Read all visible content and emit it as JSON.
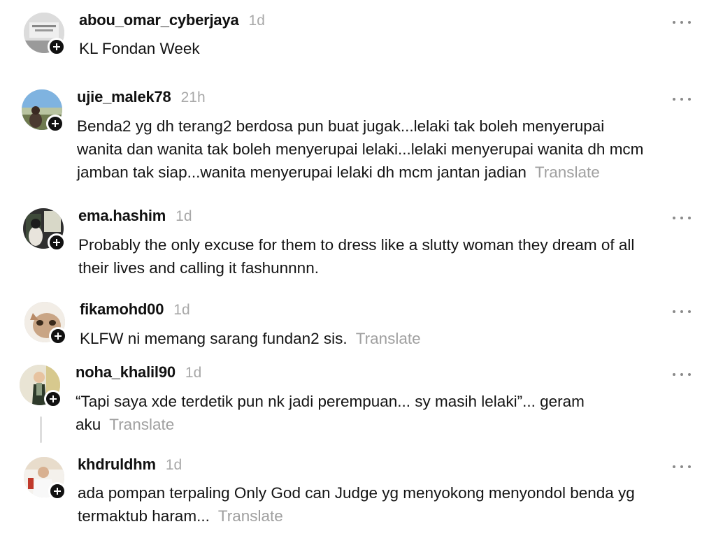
{
  "comments": [
    {
      "username": "abou_omar_cyberjaya",
      "time": "1d",
      "lines": [
        "KL Fondan Week"
      ],
      "translate": ""
    },
    {
      "username": "ujie_malek78",
      "time": "21h",
      "lines": [
        "Benda2 yg dh terang2 berdosa pun buat jugak...lelaki tak boleh menyerupai",
        "wanita dan wanita tak boleh menyerupai lelaki...lelaki menyerupai wanita dh mcm",
        "jamban tak siap...wanita menyerupai lelaki dh mcm jantan jadian"
      ],
      "translate": "Translate"
    },
    {
      "username": "ema.hashim",
      "time": "1d",
      "lines": [
        "Probably the only excuse for them to dress like a slutty woman they dream of all",
        "their lives and calling it fashunnnn."
      ],
      "translate": ""
    },
    {
      "username": "fikamohd00",
      "time": "1d",
      "lines": [
        "KLFW ni memang sarang fundan2 sis."
      ],
      "translate": "Translate"
    },
    {
      "username": "noha_khalil90",
      "time": "1d",
      "lines": [
        "“Tapi saya xde terdetik pun nk jadi perempuan... sy masih lelaki”... geram",
        "aku"
      ],
      "translate": "Translate"
    },
    {
      "username": "khdruldhm",
      "time": "1d",
      "lines": [
        "ada pompan terpaling Only God can Judge yg menyokong menyondol benda yg",
        "termaktub haram..."
      ],
      "translate": "Translate"
    }
  ],
  "icons": {
    "follow": "plus-icon",
    "more": "more-horizontal-icon"
  },
  "colors": {
    "username": "#111111",
    "muted": "#a8a8a8",
    "follow_badge": "#111111"
  }
}
